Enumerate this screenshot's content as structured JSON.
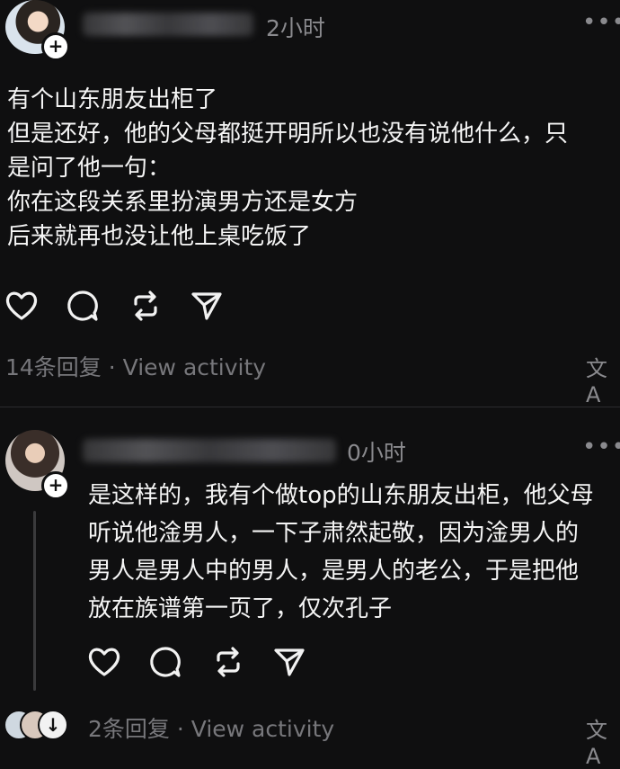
{
  "post1": {
    "time": "2小时",
    "more_label": "•••",
    "add_icon": "plus-icon",
    "lines": [
      "有个山东朋友出柜了",
      "但是还好，他的父母都挺开明所以也没有说他什么，只",
      "是问了他一句：",
      "你在这段关系里扮演男方还是女方",
      "后来就再也没让他上桌吃饭了"
    ],
    "actions": [
      "heart-icon",
      "comment-icon",
      "repost-icon",
      "share-icon"
    ],
    "replies": "14条回复",
    "separator": "·",
    "view_activity": "View activity",
    "translate_icon": "文A"
  },
  "post2": {
    "time": "0小时",
    "more_label": "•••",
    "add_icon": "plus-icon",
    "lines": [
      "是这样的，我有个做top的山东朋友出柜，他父母",
      "听说他淦男人，一下子肃然起敬，因为淦男人的",
      "男人是男人中的男人，是男人的老公，于是把他",
      "放在族谱第一页了，仅次孔子"
    ],
    "actions": [
      "heart-icon",
      "comment-icon",
      "repost-icon",
      "share-icon"
    ],
    "replies": "2条回复",
    "separator": "·",
    "view_activity": "View activity",
    "translate_icon": "文A"
  }
}
